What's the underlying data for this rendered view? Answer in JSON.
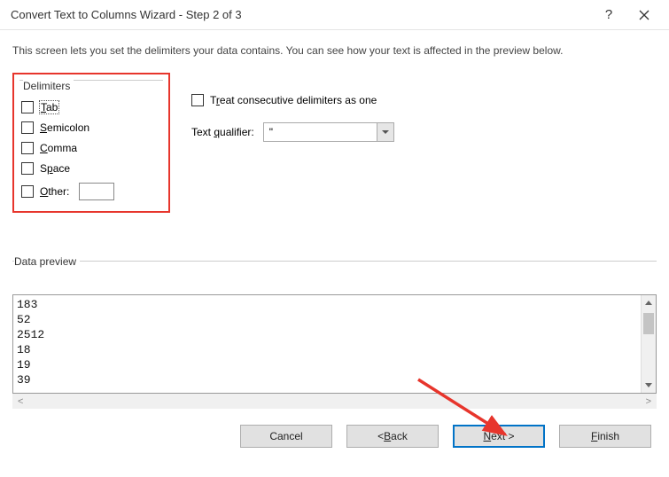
{
  "titlebar": {
    "title": "Convert Text to Columns Wizard - Step 2 of 3"
  },
  "intro": "This screen lets you set the delimiters your data contains.  You can see how your text is affected in the preview below.",
  "delimiters": {
    "legend": "Delimiters",
    "tab": "ab",
    "semicolon": "emicolon",
    "comma": "omma",
    "space": "pace",
    "other": "ther:"
  },
  "options": {
    "treat_consecutive": "reat consecutive delimiters as one",
    "qualifier_label": "ualifier:",
    "qualifier_label_prefix": "Text ",
    "qualifier_value": "\""
  },
  "preview": {
    "legend": "Data preview",
    "rows": [
      "183",
      "52",
      "2512",
      "18",
      "19",
      "39"
    ]
  },
  "buttons": {
    "cancel": "Cancel",
    "back": "ack",
    "back_prefix": "< ",
    "next": "ext >",
    "finish": "inish"
  }
}
